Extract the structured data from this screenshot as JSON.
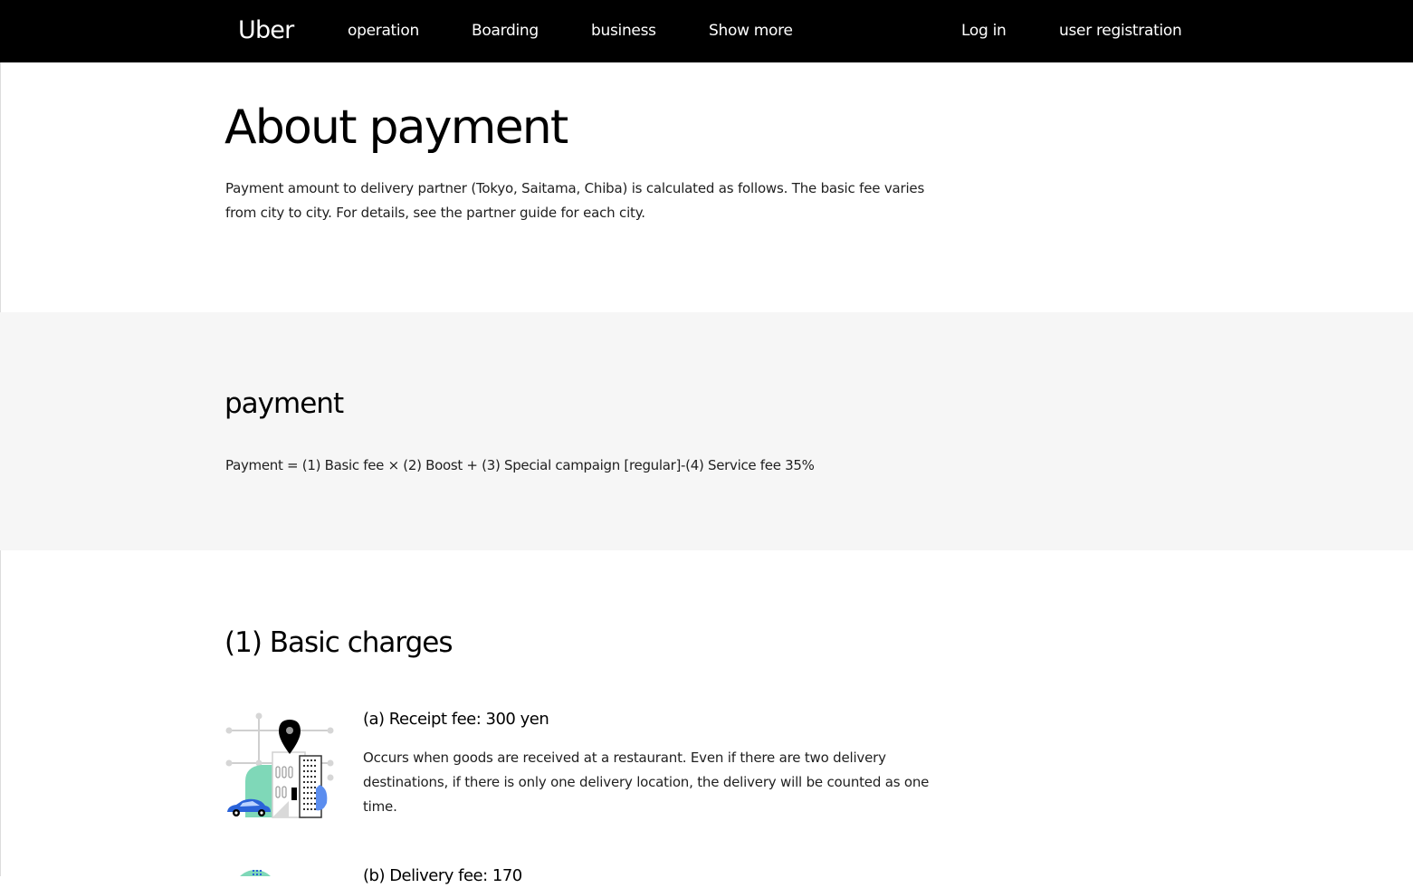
{
  "nav": {
    "logo": "Uber",
    "links": [
      "operation",
      "Boarding",
      "business",
      "Show more"
    ],
    "login": "Log in",
    "register": "user registration"
  },
  "hero": {
    "title": "About payment",
    "intro": "Payment amount to delivery partner (Tokyo, Saitama, Chiba) is calculated as follows. The basic fee varies from city to city. For details, see the partner guide for each city."
  },
  "payment_section": {
    "heading": "payment",
    "formula": "Payment = (1) Basic fee × (2) Boost + (3) Special campaign [regular]-(4) Service fee 35%"
  },
  "basic_charges": {
    "heading": "(1) Basic charges",
    "items": [
      {
        "title": "(a) Receipt fee: 300 yen",
        "description": "Occurs when goods are received at a restaurant. Even if there are two delivery destinations, if there is only one delivery location, the delivery will be counted as one time.",
        "icon": "map-pin-city-icon"
      },
      {
        "title": "(b) Delivery fee: 170",
        "icon": "globe-city-icon"
      }
    ]
  },
  "colors": {
    "topbar": "#000000",
    "band": "#f6f6f6",
    "accent_green": "#7fd8b8",
    "accent_blue": "#5b8def"
  }
}
